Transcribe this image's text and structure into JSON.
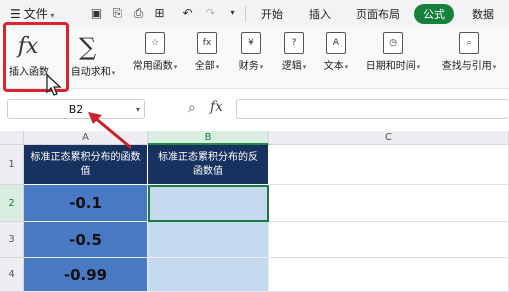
{
  "menubar": {
    "file_label": "文件",
    "tabs": [
      "开始",
      "插入",
      "页面布局",
      "公式",
      "数据"
    ],
    "active_tab": "公式"
  },
  "ribbon": {
    "insert_function": "插入函数",
    "autosum": "自动求和",
    "common_functions": "常用函数",
    "all": "全部",
    "finance": "财务",
    "logic": "逻辑",
    "text": "文本",
    "datetime": "日期和时间",
    "lookup": "查找与引用"
  },
  "formula_bar": {
    "name_box": "B2",
    "formula": ""
  },
  "grid": {
    "columns": [
      "A",
      "B",
      "C"
    ],
    "rows": [
      "1",
      "2",
      "3",
      "4"
    ],
    "a1": "标准正态累积分布的函数值",
    "b1": "标准正态累积分布的反函数值",
    "a_values": [
      "-0.1",
      "-0.5",
      "-0.99"
    ]
  },
  "colors": {
    "accent_green": "#16803c",
    "header_navy": "#17325f",
    "value_blue": "#4a79c4",
    "light_blue": "#c5d9ef",
    "highlight_red": "#d8242a"
  }
}
